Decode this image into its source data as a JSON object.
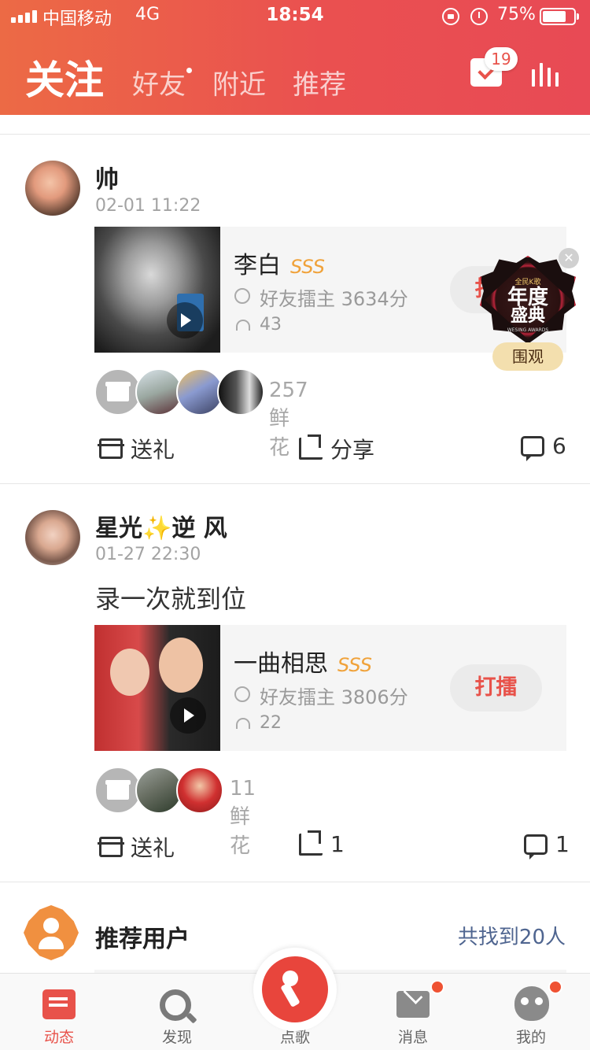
{
  "status_bar": {
    "carrier": "中国移动",
    "network": "4G",
    "time": "18:54",
    "battery": "75%"
  },
  "header": {
    "tabs": [
      {
        "label": "关注",
        "active": true
      },
      {
        "label": "好友",
        "has_dot": true
      },
      {
        "label": "附近"
      },
      {
        "label": "推荐"
      }
    ],
    "checkin_badge": "19",
    "accent_color": "#e8524a"
  },
  "posts": [
    {
      "username": "帅",
      "time": "02-01 11:22",
      "caption": "",
      "song": {
        "title": "李白",
        "grade": "SSS",
        "rank": "好友擂主 3634分",
        "listens": "43",
        "action": "打擂"
      },
      "flowers": "257鲜花",
      "actions": {
        "gift": "送礼",
        "share": "分享",
        "comments": "6"
      }
    },
    {
      "username": "星光✨逆 风",
      "time": "01-27 22:30",
      "caption": "录一次就到位",
      "song": {
        "title": "一曲相思",
        "grade": "SSS",
        "rank": "好友擂主 3806分",
        "listens": "22",
        "action": "打擂"
      },
      "flowers": "11鲜花",
      "actions": {
        "gift": "送礼",
        "share": "1",
        "comments": "1"
      }
    }
  ],
  "award_badge": {
    "logo": "全民K歌",
    "line1": "年度",
    "line2": "盛典",
    "sub": "WESING AWARDS",
    "button": "围观"
  },
  "recommend": {
    "title": "推荐用户",
    "count": "共找到20人"
  },
  "bottom_nav": {
    "items": [
      {
        "label": "动态",
        "active": true
      },
      {
        "label": "发现"
      },
      {
        "label": "点歌"
      },
      {
        "label": "消息",
        "has_dot": true
      },
      {
        "label": "我的",
        "has_dot": true
      }
    ]
  }
}
